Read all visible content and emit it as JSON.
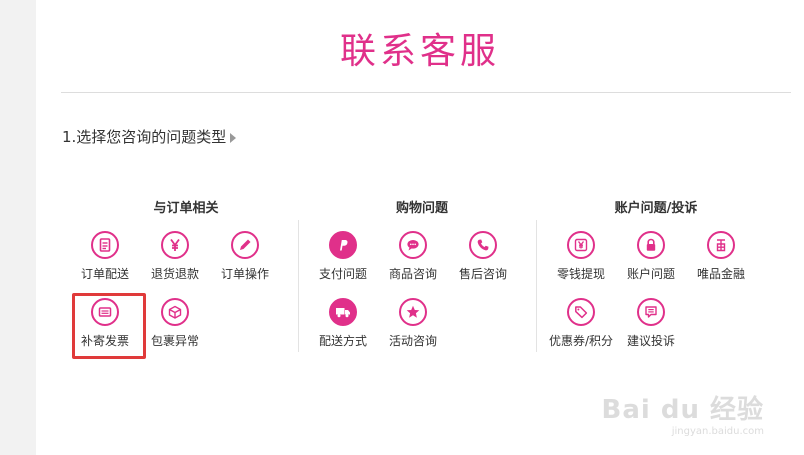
{
  "header": {
    "title": "联系客服"
  },
  "step": {
    "text": "1.选择您咨询的问题类型"
  },
  "groups": [
    {
      "title": "与订单相关",
      "items": [
        {
          "label": "订单配送",
          "icon": "document-icon"
        },
        {
          "label": "退货退款",
          "icon": "yen-icon"
        },
        {
          "label": "订单操作",
          "icon": "pencil-icon"
        },
        {
          "label": "补寄发票",
          "icon": "invoice-icon"
        },
        {
          "label": "包裹异常",
          "icon": "package-icon"
        }
      ]
    },
    {
      "title": "购物问题",
      "items": [
        {
          "label": "支付问题",
          "icon": "paypal-icon"
        },
        {
          "label": "商品咨询",
          "icon": "chat-bubble-icon"
        },
        {
          "label": "售后咨询",
          "icon": "phone-icon"
        },
        {
          "label": "配送方式",
          "icon": "truck-icon"
        },
        {
          "label": "活动咨询",
          "icon": "star-icon"
        }
      ]
    },
    {
      "title": "账户问题/投诉",
      "items": [
        {
          "label": "零钱提现",
          "icon": "wallet-yen-icon"
        },
        {
          "label": "账户问题",
          "icon": "lock-icon"
        },
        {
          "label": "唯品金融",
          "icon": "finance-icon"
        },
        {
          "label": "优惠券/积分",
          "icon": "tag-icon"
        },
        {
          "label": "建议投诉",
          "icon": "feedback-icon"
        }
      ]
    }
  ],
  "watermark": {
    "main": "Bai du 经验",
    "sub": "jingyan.baidu.com"
  },
  "colors": {
    "accent": "#e0308a",
    "highlight": "#e03a3a"
  }
}
